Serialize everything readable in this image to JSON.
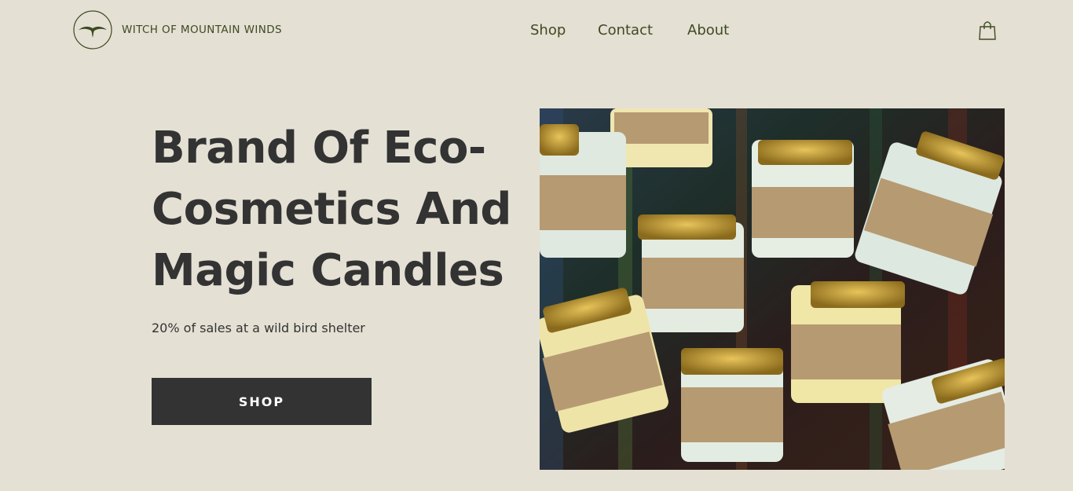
{
  "header": {
    "logo": {
      "icon": "bird-emblem-icon"
    },
    "brand_name": "WITCH OF MOUNTAIN WINDS",
    "nav": [
      "Shop",
      "Contact",
      "About"
    ],
    "cart": {
      "icon": "shopping-bag-icon"
    }
  },
  "hero": {
    "title_lines": [
      "Brand Of Eco-",
      "Cosmetics And",
      "Magic Candles"
    ],
    "subtitle": "20% of sales at a wild bird shelter",
    "cta_label": "SHOP"
  },
  "colors": {
    "background": "#e4e0d4",
    "brand_green": "#3e4a21",
    "text_dark": "#333333",
    "button_bg": "#333333",
    "button_text": "#ffffff"
  }
}
